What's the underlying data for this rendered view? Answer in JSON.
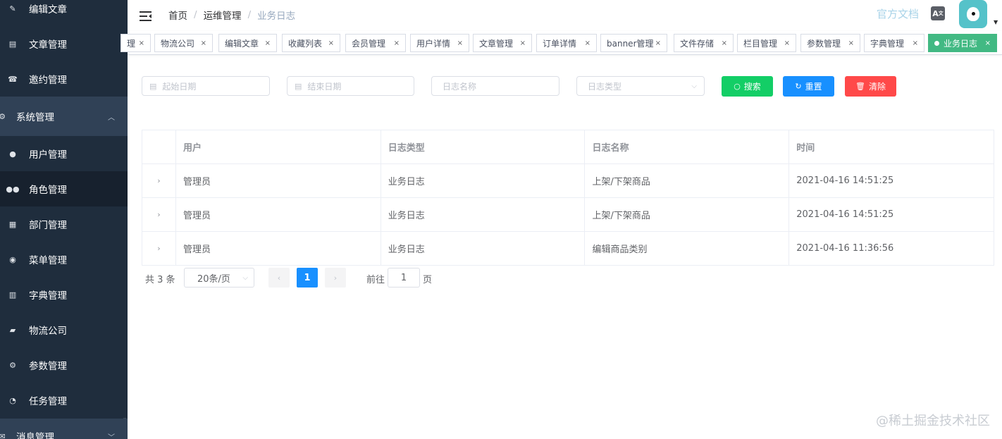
{
  "sidebar": {
    "items": [
      {
        "label": "编辑文章",
        "icon": "edit-icon"
      },
      {
        "label": "文章管理",
        "icon": "document-icon"
      },
      {
        "label": "邀约管理",
        "icon": "phone-icon"
      },
      {
        "label": "系统管理",
        "icon": "gear-icon",
        "group": true,
        "expanded": true
      },
      {
        "label": "用户管理",
        "icon": "user-icon"
      },
      {
        "label": "角色管理",
        "icon": "users-icon",
        "active": true
      },
      {
        "label": "部门管理",
        "icon": "department-icon"
      },
      {
        "label": "菜单管理",
        "icon": "menu-icon"
      },
      {
        "label": "字典管理",
        "icon": "dictionary-icon"
      },
      {
        "label": "物流公司",
        "icon": "truck-icon"
      },
      {
        "label": "参数管理",
        "icon": "parameters-icon"
      },
      {
        "label": "任务管理",
        "icon": "clock-icon"
      },
      {
        "label": "消息管理",
        "icon": "message-icon",
        "group": true
      }
    ]
  },
  "navbar": {
    "breadcrumb": [
      "首页",
      "运维管理",
      "业务日志"
    ],
    "doc_link": "官方文档",
    "lang_icon": "translate-icon",
    "avatar_icon": "avatar-icon"
  },
  "tags": [
    {
      "label": "理"
    },
    {
      "label": "物流公司"
    },
    {
      "label": "编辑文章"
    },
    {
      "label": "收藏列表"
    },
    {
      "label": "会员管理"
    },
    {
      "label": "用户详情"
    },
    {
      "label": "文章管理"
    },
    {
      "label": "订单详情"
    },
    {
      "label": "banner管理"
    },
    {
      "label": "文件存储"
    },
    {
      "label": "栏目管理"
    },
    {
      "label": "参数管理"
    },
    {
      "label": "字典管理"
    },
    {
      "label": "业务日志",
      "active": true
    }
  ],
  "tag_close": "×",
  "filters": {
    "start_date": "起始日期",
    "end_date": "结束日期",
    "log_name": "日志名称",
    "log_type": "日志类型",
    "search": "搜索",
    "reset": "重置",
    "clear": "清除",
    "colors": {
      "search": "#13ce66",
      "reset": "#1890ff",
      "clear": "#ff4949"
    }
  },
  "table": {
    "columns": [
      "用户",
      "日志类型",
      "日志名称",
      "时间"
    ],
    "rows": [
      [
        "管理员",
        "业务日志",
        "上架/下架商品",
        "2021-04-16 14:51:25"
      ],
      [
        "管理员",
        "业务日志",
        "上架/下架商品",
        "2021-04-16 14:51:25"
      ],
      [
        "管理员",
        "业务日志",
        "编辑商品类别",
        "2021-04-16 11:36:56"
      ]
    ]
  },
  "pagination": {
    "total": "共 3 条",
    "page_size": "20条/页",
    "current_page": "1",
    "goto_label": "前往",
    "goto_value": "1",
    "page_unit": "页"
  },
  "watermark": "@稀土掘金技术社区"
}
